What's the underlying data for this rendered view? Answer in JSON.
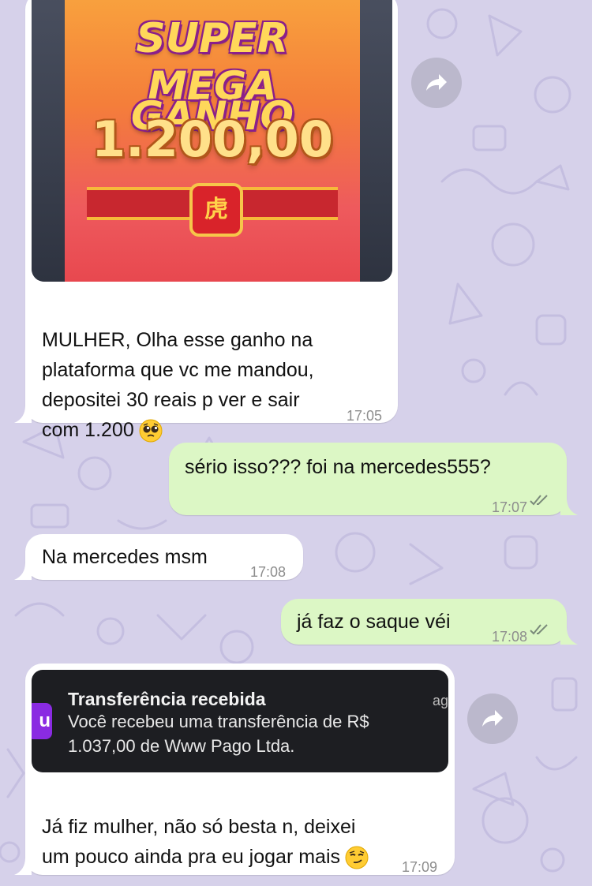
{
  "chat": {
    "messages": [
      {
        "direction": "incoming",
        "image": {
          "headline_top": "SUPER",
          "headline_mid": "MEGA GANHO",
          "amount": "1.200,00",
          "emblem": "虎"
        },
        "text": "MULHER, Olha esse ganho na\nplataforma que vc me mandou,\ndepositei 30 reais p ver e sair\ncom 1.200",
        "emoji": "pleading-face",
        "time": "17:05"
      },
      {
        "direction": "outgoing",
        "text": "sério isso??? foi na mercedes555?",
        "time": "17:07",
        "status": "read"
      },
      {
        "direction": "incoming",
        "text": "Na mercedes msm",
        "time": "17:08"
      },
      {
        "direction": "outgoing",
        "text": "já faz o saque véi",
        "time": "17:08",
        "status": "read"
      },
      {
        "direction": "incoming",
        "notification": {
          "app_letter": "u",
          "title": "Transferência recebida",
          "body": "Você recebeu uma transferência de R$\n1.037,00 de Www Pago Ltda.",
          "ago": "ag"
        },
        "text": "Já fiz mulher, não só besta n, deixei\num pouco ainda pra eu jogar mais",
        "emoji": "smirking-face",
        "time": "17:09"
      }
    ]
  },
  "icons": {
    "forward": "forward-arrow-icon",
    "read_ticks": "double-check-icon"
  },
  "colors": {
    "background": "#d6d1ea",
    "incoming_bubble": "#ffffff",
    "outgoing_bubble": "#dcf7c5",
    "timestamp": "#8d8d8d"
  }
}
